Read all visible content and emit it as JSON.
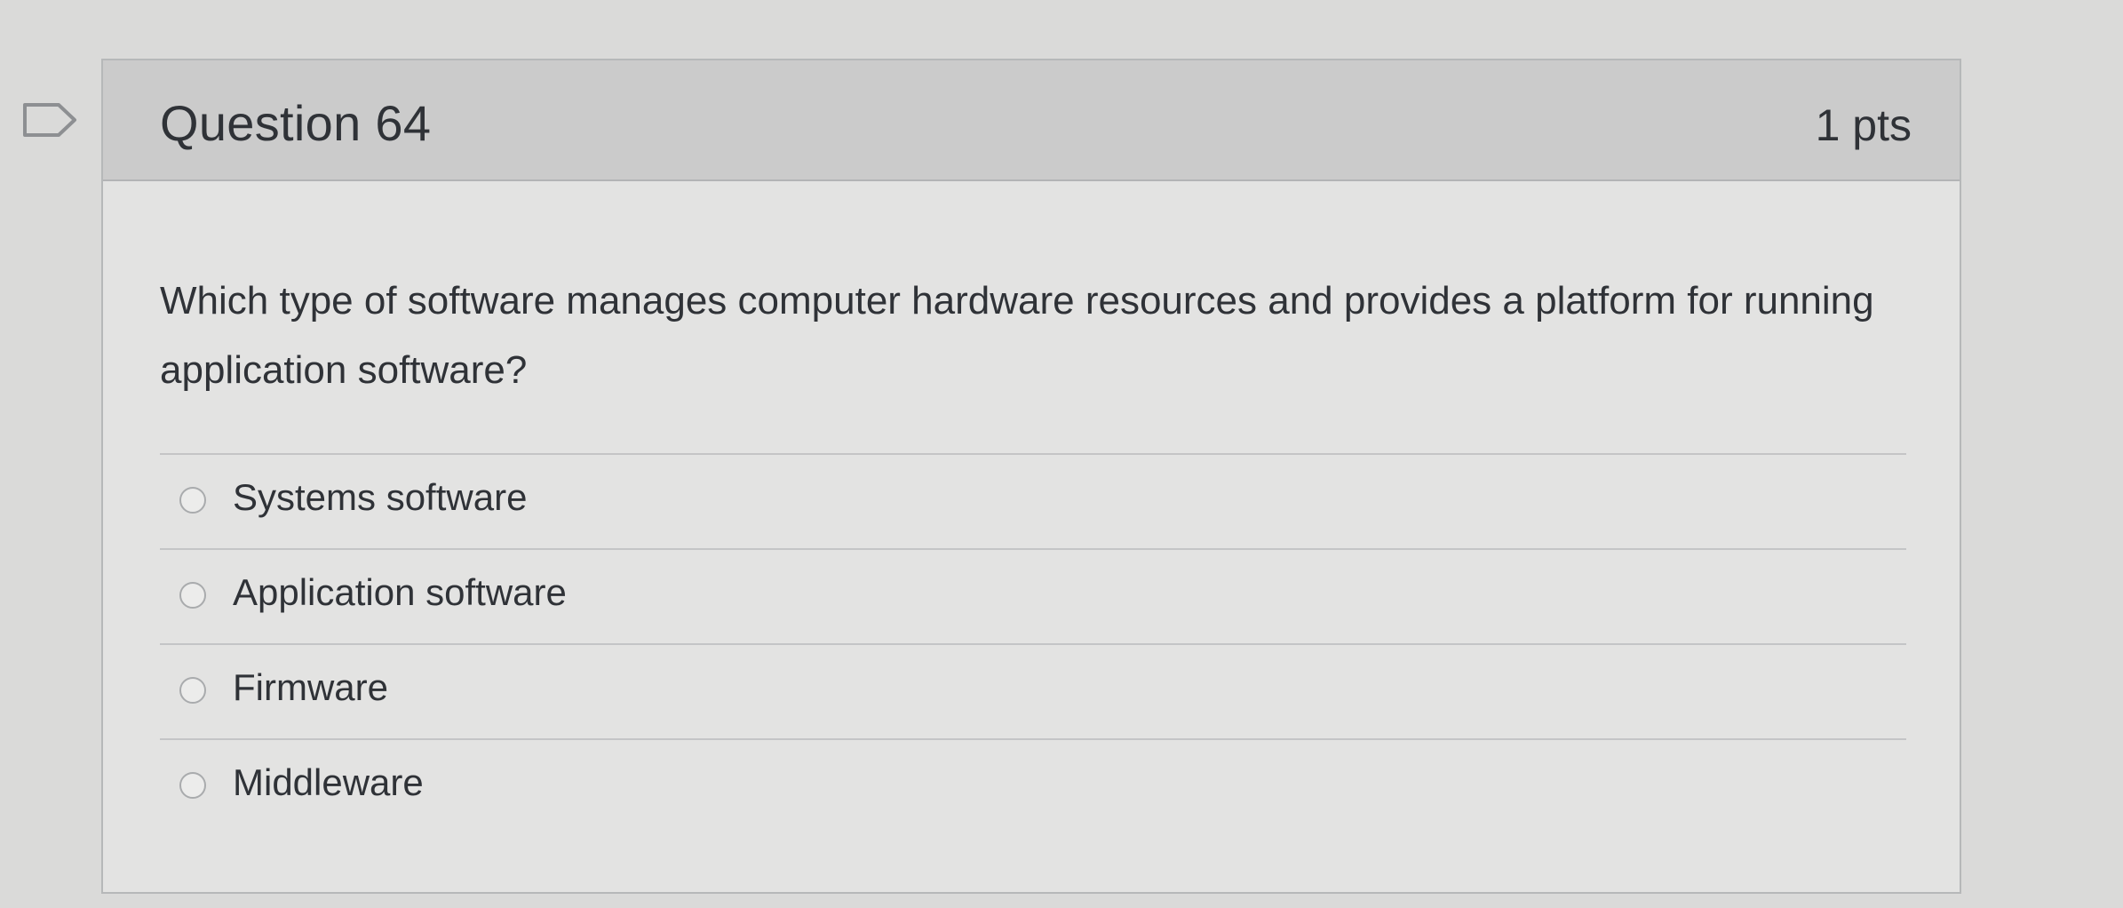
{
  "question": {
    "title": "Question 64",
    "points": "1 pts",
    "text": "Which type of software manages computer hardware resources and provides a platform for running application software?"
  },
  "answers": [
    {
      "label": "Systems software",
      "selected": false
    },
    {
      "label": "Application software",
      "selected": false
    },
    {
      "label": "Firmware",
      "selected": false
    },
    {
      "label": "Middleware",
      "selected": false
    }
  ],
  "icons": {
    "flag": "flag-outline-icon"
  }
}
